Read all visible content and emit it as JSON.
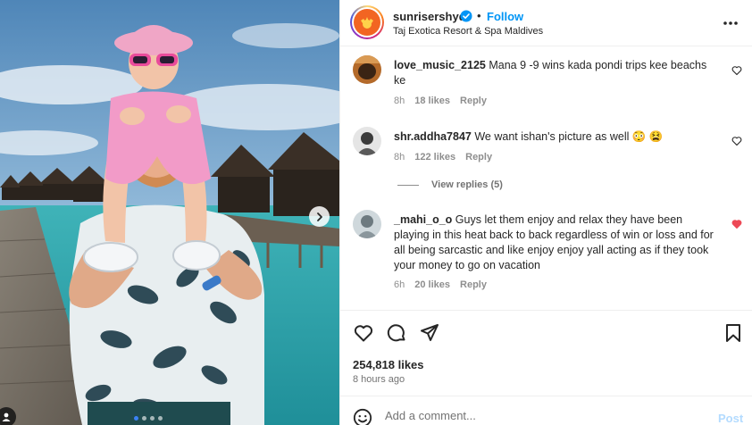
{
  "post": {
    "username": "sunrisershyd",
    "dot": "•",
    "follow_label": "Follow",
    "location": "Taj Exotica Resort & Spa Maldives",
    "likes": "254,818 likes",
    "time_ago": "8 hours ago"
  },
  "comments": [
    {
      "user": "love_music_2125",
      "text": "Mana 9 -9 wins kada pondi trips kee beachs ke",
      "age": "8h",
      "likes": "18 likes",
      "reply_label": "Reply",
      "liked": false
    },
    {
      "user": "shr.addha7847",
      "text": "We want ishan's picture as well 😳 😫",
      "age": "8h",
      "likes": "122 likes",
      "reply_label": "Reply",
      "liked": false,
      "view_replies": "View replies (5)"
    },
    {
      "user": "_mahi_o_o",
      "text": "Guys let them enjoy and relax they have been playing in this heat back to back regardless of win or loss and for all being sarcastic and like enjoy enjoy yall acting as if they took your money to go on vacation",
      "age": "6h",
      "likes": "20 likes",
      "reply_label": "Reply",
      "liked": true
    }
  ],
  "add_comment": {
    "placeholder": "Add a comment...",
    "post_label": "Post"
  },
  "colors": {
    "accent": "#0095f6",
    "liked_heart": "#ed4956",
    "post_disabled": "#b3dbff"
  },
  "icons": [
    "verified-badge-icon",
    "more-options-icon",
    "heart-icon",
    "comment-icon",
    "share-icon",
    "save-icon",
    "emoji-icon",
    "next-arrow-icon",
    "user-tag-icon"
  ]
}
